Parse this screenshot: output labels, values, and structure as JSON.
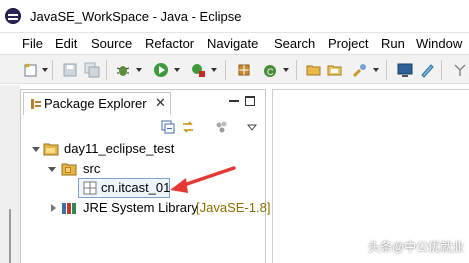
{
  "window": {
    "title": "JavaSE_WorkSpace - Java - Eclipse"
  },
  "menu": [
    "File",
    "Edit",
    "Source",
    "Refactor",
    "Navigate",
    "Search",
    "Project",
    "Run",
    "Window"
  ],
  "toolbar_icons": [
    "new-icon",
    "save-icon",
    "save-all-icon",
    "debug-icon",
    "run-icon",
    "run-external-icon",
    "new-java-package-icon",
    "new-java-class-icon",
    "open-type-icon",
    "open-folder-icon",
    "search-icon",
    "console-icon",
    "pen-icon",
    "toggle-mark-icon"
  ],
  "package_explorer": {
    "tab_label": "Package Explorer",
    "close_glyph": "✕",
    "tree": {
      "project": "day11_eclipse_test",
      "src": "src",
      "package": "cn.itcast_01",
      "jre": "JRE System Library",
      "jre_version": "[JavaSE-1.8]"
    }
  },
  "annotation": {
    "arrow_color": "#e53935"
  },
  "watermark": "头条@中公优就业",
  "colors": {
    "toolbar_bg": "#f2f2f2",
    "selection_border": "#7da2ce",
    "selection_bg": "#eef5fd"
  }
}
